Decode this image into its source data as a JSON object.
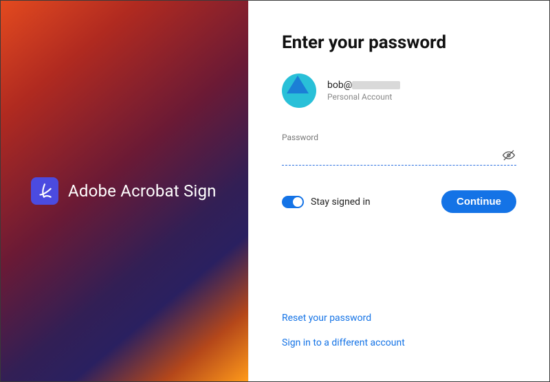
{
  "brand": {
    "product_name": "Adobe Acrobat Sign"
  },
  "panel": {
    "title": "Enter your password",
    "account": {
      "email_prefix": "bob@",
      "subtype": "Personal Account"
    },
    "password": {
      "label": "Password",
      "value": ""
    },
    "stay_signed_in": {
      "label": "Stay signed in",
      "checked": true
    },
    "continue_label": "Continue",
    "links": {
      "reset_password": "Reset your password",
      "different_account": "Sign in to a different account"
    }
  },
  "colors": {
    "accent": "#1473e6"
  }
}
